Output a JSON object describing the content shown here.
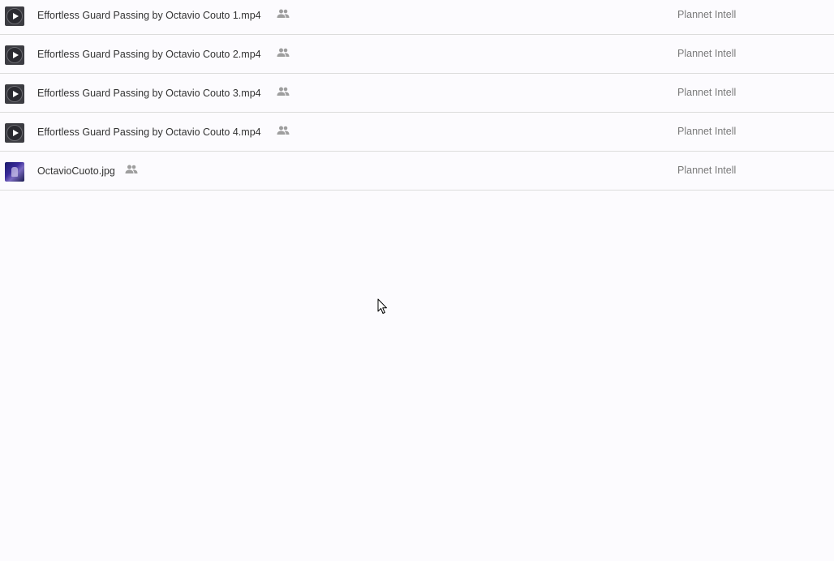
{
  "files": [
    {
      "name": "Effortless Guard Passing by Octavio Couto 1.mp4",
      "owner": "Plannet Intell",
      "type": "video",
      "icon": "play-icon",
      "shared_icon": "people-icon"
    },
    {
      "name": "Effortless Guard Passing by Octavio Couto 2.mp4",
      "owner": "Plannet Intell",
      "type": "video",
      "icon": "play-icon",
      "shared_icon": "people-icon"
    },
    {
      "name": "Effortless Guard Passing by Octavio Couto 3.mp4",
      "owner": "Plannet Intell",
      "type": "video",
      "icon": "play-icon",
      "shared_icon": "people-icon"
    },
    {
      "name": "Effortless Guard Passing by Octavio Couto 4.mp4",
      "owner": "Plannet Intell",
      "type": "video",
      "icon": "play-icon",
      "shared_icon": "people-icon"
    },
    {
      "name": "OctavioCuoto.jpg",
      "owner": "Plannet Intell",
      "type": "image",
      "icon": "image-thumbnail",
      "shared_icon": "people-icon"
    }
  ],
  "colors": {
    "background": "#fcfbfe",
    "text": "#333333",
    "owner_text": "#7a7a7a",
    "divider": "#dcdcdc"
  }
}
